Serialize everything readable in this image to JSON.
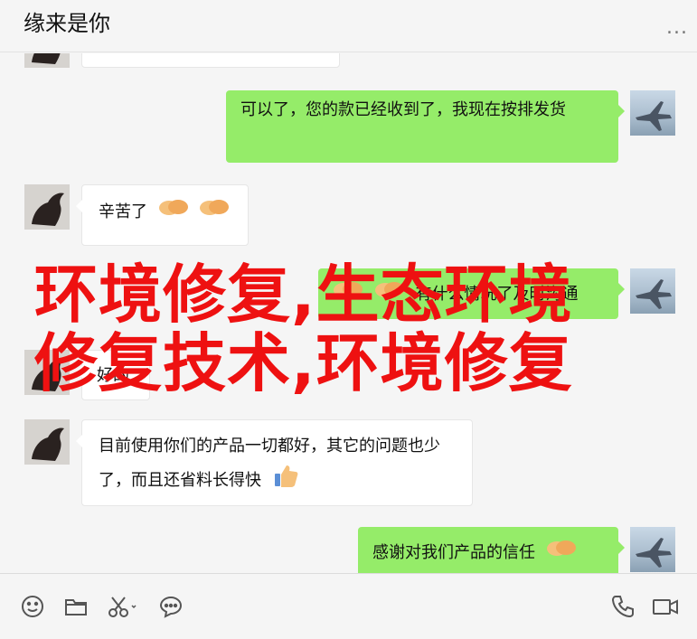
{
  "header": {
    "title": "缘来是你",
    "more": "..."
  },
  "messages": [
    {
      "side": "in",
      "text": ""
    },
    {
      "side": "out",
      "text": "可以了，您的款已经收到了，我现在按排发货"
    },
    {
      "side": "in",
      "text": "辛苦了"
    },
    {
      "side": "out",
      "text": "有什么情况了及时沟通"
    },
    {
      "side": "in",
      "text": "好的"
    },
    {
      "side": "in",
      "text": "目前使用你们的产品一切都好，其它的问题也少了，而且还省料长得快"
    },
    {
      "side": "out",
      "text": "感谢对我们产品的信任"
    }
  ],
  "overlay": {
    "line1": "环境修复,生态环境",
    "line2": "修复技术,环境修复"
  },
  "footer": {
    "icons": [
      "emoji-icon",
      "folder-icon",
      "scissors-icon",
      "chat-bubble-icon",
      "phone-icon",
      "video-camera-icon"
    ]
  },
  "colors": {
    "out_bubble": "#95ec69",
    "in_bubble": "#ffffff",
    "overlay_text": "#ee1111",
    "background": "#f5f5f5"
  }
}
